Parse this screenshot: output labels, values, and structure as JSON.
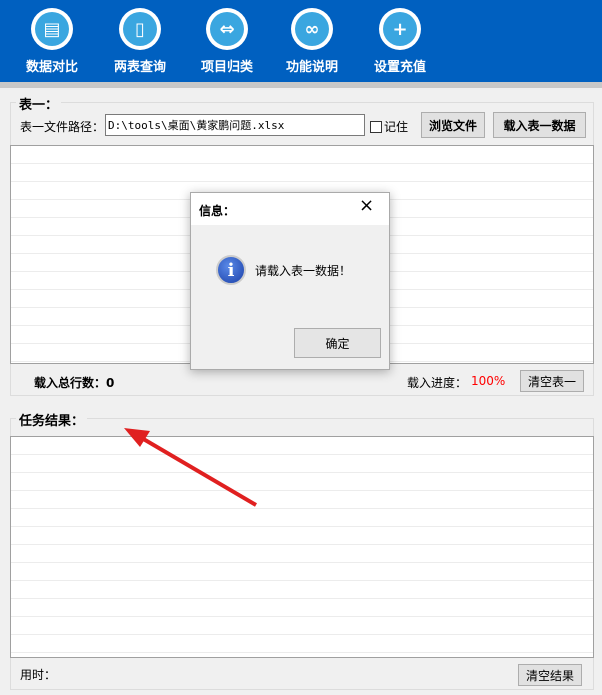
{
  "toolbar": {
    "items": [
      {
        "label": "数据对比",
        "icon": "▤"
      },
      {
        "label": "两表查询",
        "icon": "▯"
      },
      {
        "label": "项目归类",
        "icon": "⇔"
      },
      {
        "label": "功能说明",
        "icon": "∞"
      },
      {
        "label": "设置充值",
        "icon": "+"
      }
    ]
  },
  "table1": {
    "group_label": "表一：",
    "path_label": "表一文件路径：",
    "path_value": "D:\\tools\\桌面\\黄家鹏问题.xlsx",
    "remember_label": "记住",
    "browse_label": "浏览文件",
    "load_label": "载入表一数据",
    "total_rows_label": "载入总行数：0",
    "progress_label": "载入进度：",
    "progress_value": "100%",
    "clear_label": "清空表一"
  },
  "results": {
    "group_label": "任务结果：",
    "time_label": "用时：",
    "clear_label": "清空结果"
  },
  "dialog": {
    "title": "信息：",
    "message": "请载入表一数据！",
    "ok_label": "确定"
  },
  "colors": {
    "toolbar": "#0060c0",
    "progress": "#ff0000",
    "arrow": "#e02020"
  }
}
